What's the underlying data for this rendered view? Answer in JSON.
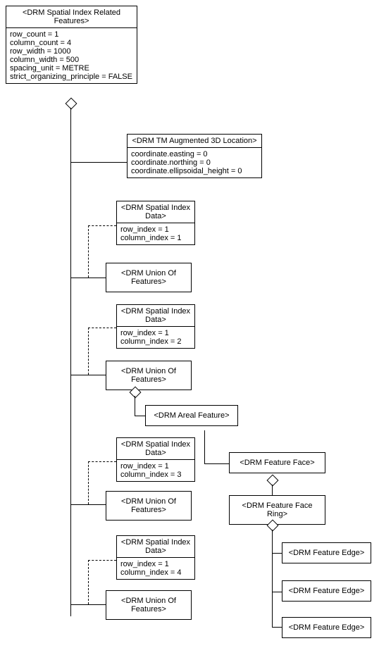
{
  "root": {
    "title": "<DRM Spatial Index Related Features>",
    "attrs": [
      "row_count = 1",
      "column_count = 4",
      "row_width = 1000",
      "column_width = 500",
      "spacing_unit = METRE",
      "strict_organizing_principle = FALSE"
    ]
  },
  "tm3d": {
    "title": "<DRM TM Augmented 3D Location>",
    "attrs": [
      "coordinate.easting = 0",
      "coordinate.northing = 0",
      "coordinate.ellipsoidal_height = 0"
    ]
  },
  "sid1": {
    "title": "<DRM Spatial Index Data>",
    "attrs": [
      "row_index = 1",
      "column_index = 1"
    ]
  },
  "uof1": {
    "title": "<DRM Union Of Features>"
  },
  "sid2": {
    "title": "<DRM Spatial Index Data>",
    "attrs": [
      "row_index = 1",
      "column_index = 2"
    ]
  },
  "uof2": {
    "title": "<DRM Union Of Features>"
  },
  "areal": {
    "title": "<DRM Areal Feature>"
  },
  "sid3": {
    "title": "<DRM Spatial Index Data>",
    "attrs": [
      "row_index = 1",
      "column_index = 3"
    ]
  },
  "uof3": {
    "title": "<DRM Union Of Features>"
  },
  "face": {
    "title": "<DRM Feature Face>"
  },
  "ring": {
    "title": "<DRM Feature Face Ring>"
  },
  "sid4": {
    "title": "<DRM Spatial Index Data>",
    "attrs": [
      "row_index = 1",
      "column_index = 4"
    ]
  },
  "uof4": {
    "title": "<DRM Union Of Features>"
  },
  "edge1": {
    "title": "<DRM Feature Edge>"
  },
  "edge2": {
    "title": "<DRM Feature Edge>"
  },
  "edge3": {
    "title": "<DRM Feature Edge>"
  }
}
